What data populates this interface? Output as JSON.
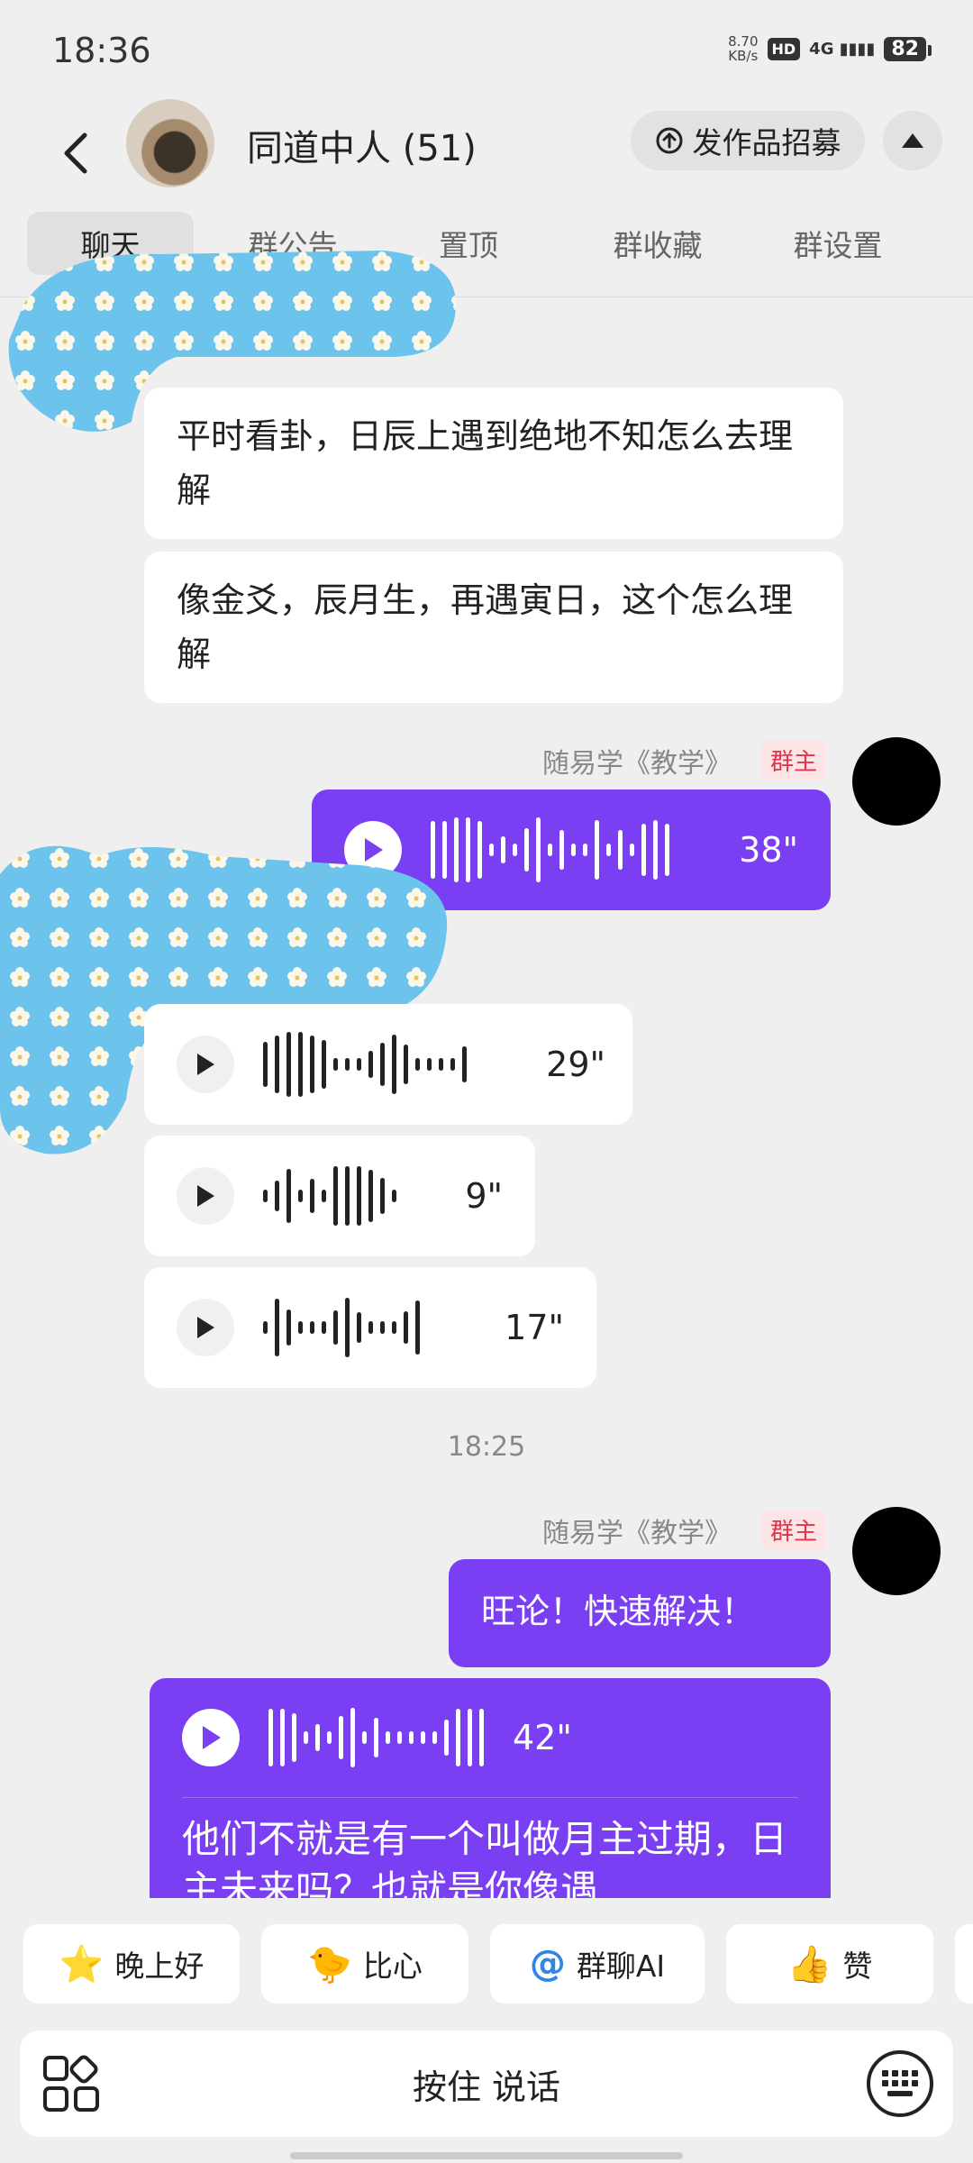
{
  "status": {
    "time": "18:36",
    "net_speed": "8.70",
    "net_unit": "KB/s",
    "hd": "HD",
    "signal": "4G",
    "battery": "82"
  },
  "header": {
    "title": "同道中人 (51)",
    "recruit_label": "发作品招募"
  },
  "tabs": [
    "聊天",
    "群公告",
    "置顶",
    "群收藏",
    "群设置"
  ],
  "messages": {
    "m1": "平时看卦，日辰上遇到绝地不知怎么去理解",
    "m2": "像金爻，辰月生，再遇寅日，这个怎么理解",
    "sender": "随易学《教学》",
    "role_badge": "群主",
    "voice1": "38\"",
    "voice2": "29\"",
    "voice3": "9\"",
    "voice4": "17\"",
    "timestamp": "18:25",
    "m_reply": "旺论！快速解决！",
    "voice5": "42\"",
    "m_long": "他们不就是有一个叫做月主过期，日主未来吗？也就是你像遇"
  },
  "quick_replies": [
    {
      "emoji": "⭐",
      "label": "晚上好"
    },
    {
      "emoji": "🐤",
      "label": "比心"
    },
    {
      "emoji": "@",
      "label": "群聊AI"
    },
    {
      "emoji": "👍",
      "label": "赞"
    }
  ],
  "input": {
    "hold_to_talk": "按住 说话"
  },
  "colors": {
    "accent": "#7a3ff2",
    "badge_text": "#e2334a",
    "sticker": "#6cc3ec"
  }
}
